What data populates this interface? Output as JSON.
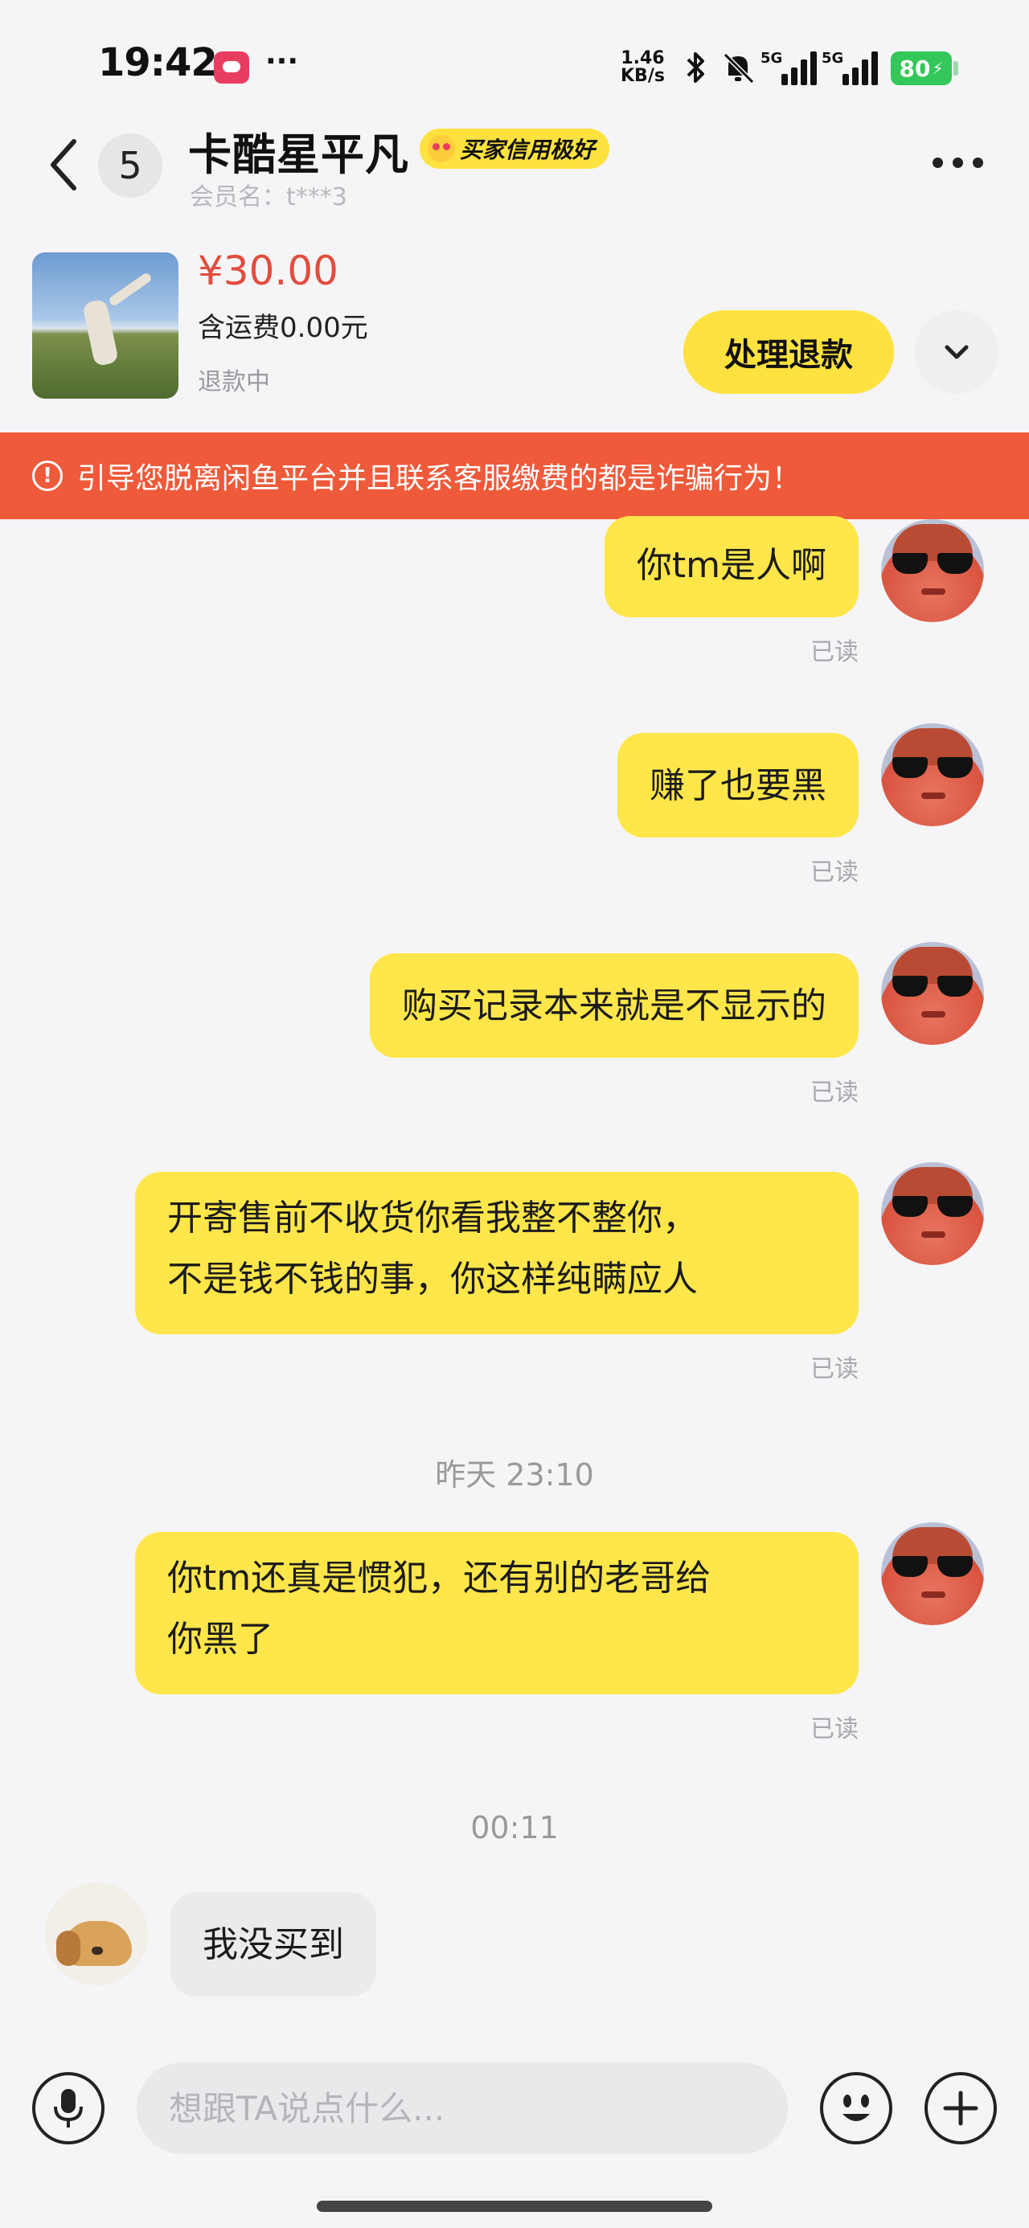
{
  "status_bar": {
    "time": "19:42",
    "more": "···",
    "speed_top": "1.46",
    "speed_bottom": "KB/s",
    "network_1": "5G",
    "network_2": "5G",
    "battery": "80"
  },
  "header": {
    "back_count": "5",
    "contact_name": "卡酷星平凡",
    "credit_badge": "买家信用极好",
    "member_name": "会员名：t***3"
  },
  "product": {
    "price": "¥30.00",
    "shipping": "含运费0.00元",
    "status": "退款中",
    "refund_button": "处理退款"
  },
  "warning_banner": {
    "text": "引导您脱离闲鱼平台并且联系客服缴费的都是诈骗行为！"
  },
  "messages": [
    {
      "text": "你tm是人啊",
      "read": "已读"
    },
    {
      "text": "赚了也要黑",
      "read": "已读"
    },
    {
      "text": "购买记录本来就是不显示的",
      "read": "已读"
    },
    {
      "line1": "开寄售前不收货你看我整不整你，",
      "line2": "不是钱不钱的事，你这样纯瞒应人",
      "read": "已读"
    },
    {
      "line1": "你tm还真是惯犯，还有别的老哥给",
      "line2": "你黑了",
      "read": "已读"
    },
    {
      "text": "我没买到"
    }
  ],
  "timestamps": {
    "t1": "昨天 23:10",
    "t2": "00:11"
  },
  "input_bar": {
    "placeholder": "想跟TA说点什么..."
  },
  "icons": {
    "back": "chevron-left-icon",
    "more": "more-horizontal-icon",
    "expand": "chevron-down-icon",
    "warning": "alert-circle-icon",
    "mic": "microphone-icon",
    "emoji": "emoji-icon",
    "plus": "plus-icon"
  },
  "colors": {
    "accent_yellow": "#ffe23f",
    "bubble_out": "#ffe64a",
    "price_red": "#e24d3f",
    "warning_banner": "#ee5a3a",
    "battery_green": "#34c759"
  }
}
